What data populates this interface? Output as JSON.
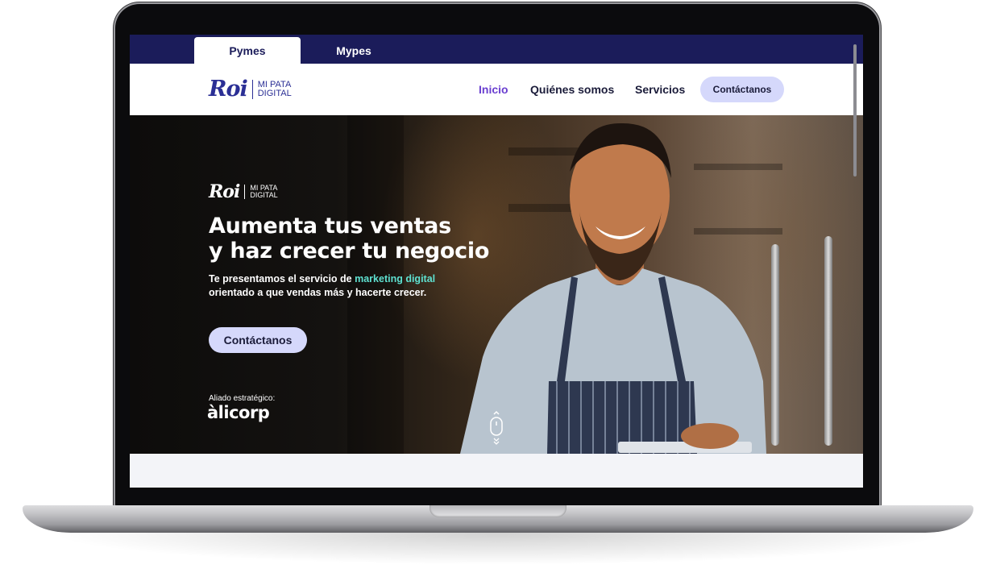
{
  "tabs": [
    {
      "label": "Pymes",
      "active": true
    },
    {
      "label": "Mypes",
      "active": false
    }
  ],
  "brand": {
    "word": "Roi",
    "sub_line1": "MI PATA",
    "sub_line2": "DIGITAL",
    "color": "#2b2f95"
  },
  "nav": {
    "links": [
      {
        "label": "Inicio",
        "active": true
      },
      {
        "label": "Quiénes somos",
        "active": false
      },
      {
        "label": "Servicios",
        "active": false
      }
    ],
    "cta_label": "Contáctanos"
  },
  "hero": {
    "headline_line1": "Aumenta tus ventas",
    "headline_line2": "y haz crecer tu negocio",
    "sub_before": "Te presentamos el servicio de ",
    "sub_highlight": "marketing digital",
    "sub_line2": "orientado a que vendas más y hacerte crecer.",
    "cta_label": "Contáctanos",
    "ally_label": "Aliado estratégico:",
    "ally_brand": "àlicorp",
    "scroll_icon": "mouse-scroll-icon"
  },
  "colors": {
    "topbar": "#1b1c5a",
    "accent_purple": "#6a3fd0",
    "cta_bg": "#d5d8fb",
    "highlight_teal": "#5ee0d0"
  }
}
